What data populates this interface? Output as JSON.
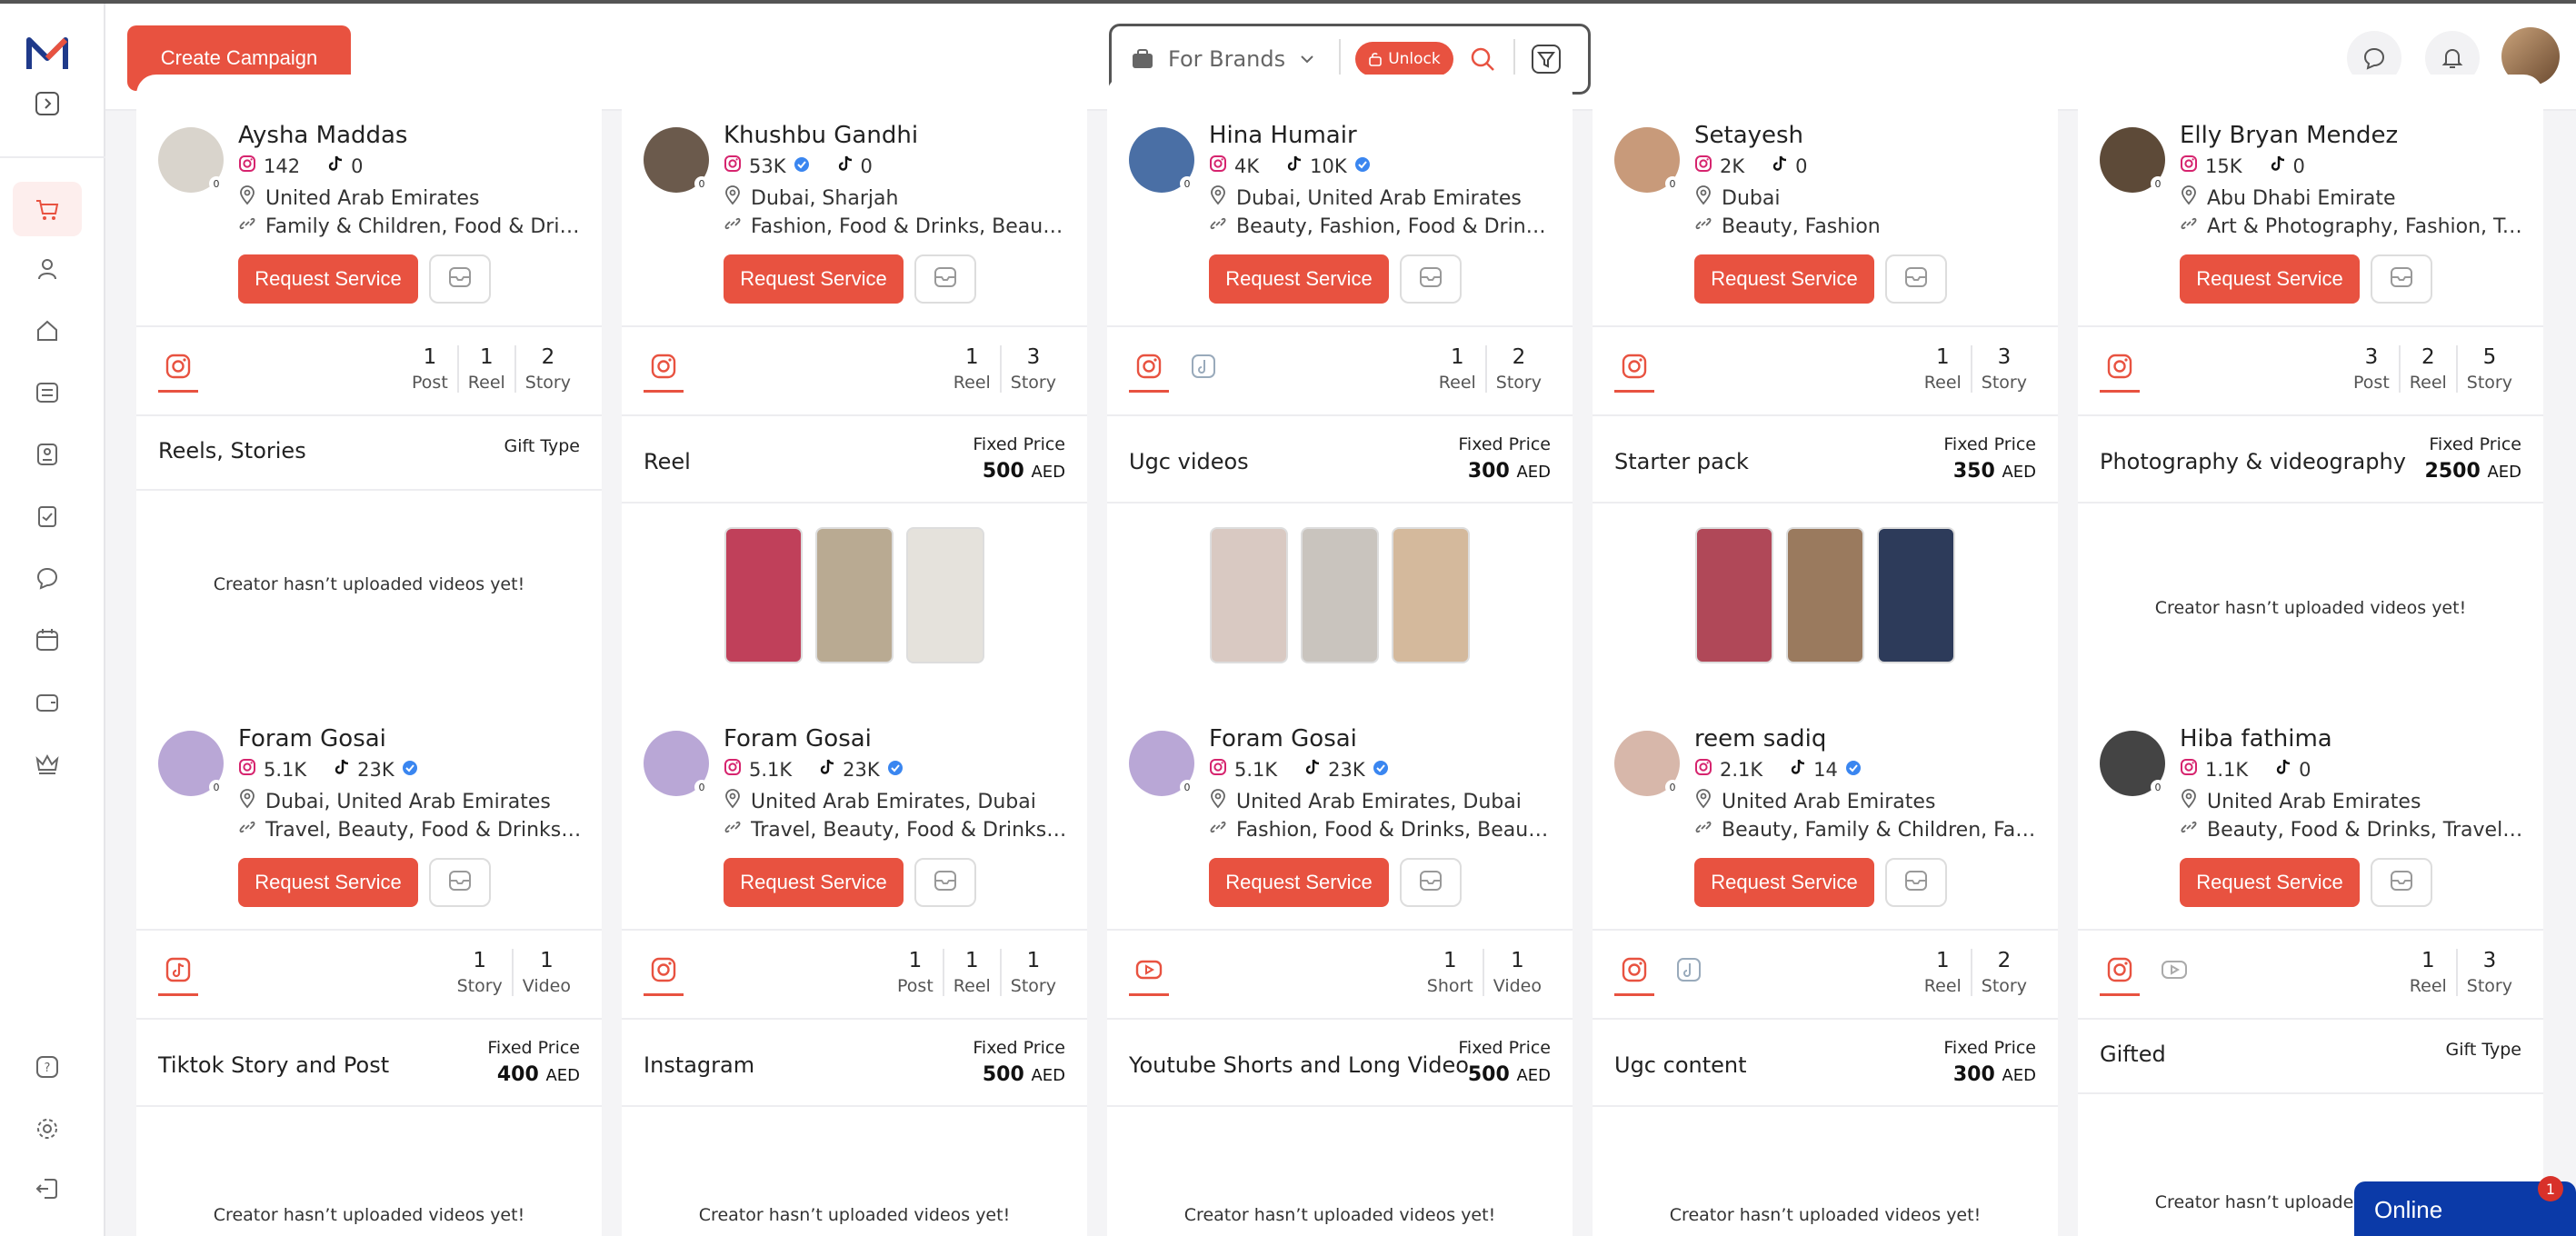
{
  "header": {
    "create_label": "Create Campaign",
    "brand_select": "For Brands",
    "unlock_label": "Unlock"
  },
  "colors": {
    "accent": "#e85240",
    "online": "#0b3aa8"
  },
  "cards": [
    {
      "name": "Aysha Maddas",
      "ig": "142",
      "tt": "0",
      "verified_ig": false,
      "verified_tt": false,
      "location": "United Arab Emirates",
      "categories": "Family & Children, Food & Drink…",
      "request": "Request Service",
      "counts": [
        {
          "n": "1",
          "l": "Post"
        },
        {
          "n": "1",
          "l": "Reel"
        },
        {
          "n": "2",
          "l": "Story"
        }
      ],
      "service": "Reels, Stories",
      "price_label": "Gift Type",
      "price_value": "",
      "currency": "",
      "no_videos": "Creator hasn’t uploaded videos yet!"
    },
    {
      "name": "Khushbu Gandhi",
      "ig": "53K",
      "tt": "0",
      "verified_ig": true,
      "verified_tt": false,
      "location": "Dubai, Sharjah",
      "categories": "Fashion, Food & Drinks, Beauty, …",
      "request": "Request Service",
      "counts": [
        {
          "n": "1",
          "l": "Reel"
        },
        {
          "n": "3",
          "l": "Story"
        }
      ],
      "service": "Reel",
      "price_label": "Fixed Price",
      "price_value": "500",
      "currency": "AED",
      "no_videos": ""
    },
    {
      "name": "Hina Humair",
      "ig": "4K",
      "tt": "10K",
      "verified_ig": false,
      "verified_tt": true,
      "location": "Dubai, United Arab Emirates",
      "categories": "Beauty, Fashion, Food & Drinks, …",
      "request": "Request Service",
      "counts": [
        {
          "n": "1",
          "l": "Reel"
        },
        {
          "n": "2",
          "l": "Story"
        }
      ],
      "service": "Ugc videos",
      "price_label": "Fixed Price",
      "price_value": "300",
      "currency": "AED",
      "no_videos": ""
    },
    {
      "name": "Setayesh",
      "ig": "2K",
      "tt": "0",
      "verified_ig": false,
      "verified_tt": false,
      "location": "Dubai",
      "categories": "Beauty, Fashion",
      "request": "Request Service",
      "counts": [
        {
          "n": "1",
          "l": "Reel"
        },
        {
          "n": "3",
          "l": "Story"
        }
      ],
      "service": "Starter pack",
      "price_label": "Fixed Price",
      "price_value": "350",
      "currency": "AED",
      "no_videos": ""
    },
    {
      "name": "Elly Bryan Mendez",
      "ig": "15K",
      "tt": "0",
      "verified_ig": false,
      "verified_tt": false,
      "location": "Abu Dhabi Emirate",
      "categories": "Art & Photography, Fashion, Te…",
      "request": "Request Service",
      "counts": [
        {
          "n": "3",
          "l": "Post"
        },
        {
          "n": "2",
          "l": "Reel"
        },
        {
          "n": "5",
          "l": "Story"
        }
      ],
      "service": "Photography & videography",
      "price_label": "Fixed Price",
      "price_value": "2500",
      "currency": "AED",
      "no_videos": "Creator hasn’t uploaded videos yet!"
    },
    {
      "name": "Foram Gosai",
      "ig": "5.1K",
      "tt": "23K",
      "verified_ig": false,
      "verified_tt": true,
      "location": "Dubai, United Arab Emirates",
      "categories": "Travel, Beauty, Food & Drinks, F…",
      "request": "Request Service",
      "counts": [
        {
          "n": "1",
          "l": "Story"
        },
        {
          "n": "1",
          "l": "Video"
        }
      ],
      "service": "Tiktok Story and Post",
      "price_label": "Fixed Price",
      "price_value": "400",
      "currency": "AED",
      "no_videos": "Creator hasn’t uploaded videos yet!"
    },
    {
      "name": "Foram Gosai",
      "ig": "5.1K",
      "tt": "23K",
      "verified_ig": false,
      "verified_tt": true,
      "location": "United Arab Emirates, Dubai",
      "categories": "Travel, Beauty, Food & Drinks, F…",
      "request": "Request Service",
      "counts": [
        {
          "n": "1",
          "l": "Post"
        },
        {
          "n": "1",
          "l": "Reel"
        },
        {
          "n": "1",
          "l": "Story"
        }
      ],
      "service": "Instagram",
      "price_label": "Fixed Price",
      "price_value": "500",
      "currency": "AED",
      "no_videos": "Creator hasn’t uploaded videos yet!"
    },
    {
      "name": "Foram Gosai",
      "ig": "5.1K",
      "tt": "23K",
      "verified_ig": false,
      "verified_tt": true,
      "location": "United Arab Emirates, Dubai",
      "categories": "Fashion, Food & Drinks, Beauty, …",
      "request": "Request Service",
      "counts": [
        {
          "n": "1",
          "l": "Short"
        },
        {
          "n": "1",
          "l": "Video"
        }
      ],
      "service": "Youtube Shorts and Long Video",
      "price_label": "Fixed Price",
      "price_value": "500",
      "currency": "AED",
      "no_videos": "Creator hasn’t uploaded videos yet!"
    },
    {
      "name": "reem sadiq",
      "ig": "2.1K",
      "tt": "14",
      "verified_ig": false,
      "verified_tt": true,
      "location": "United Arab Emirates",
      "categories": "Beauty, Family & Children, Fash…",
      "request": "Request Service",
      "counts": [
        {
          "n": "1",
          "l": "Reel"
        },
        {
          "n": "2",
          "l": "Story"
        }
      ],
      "service": "Ugc content",
      "price_label": "Fixed Price",
      "price_value": "300",
      "currency": "AED",
      "no_videos": "Creator hasn’t uploaded videos yet!"
    },
    {
      "name": "Hiba fathima",
      "ig": "1.1K",
      "tt": "0",
      "verified_ig": false,
      "verified_tt": false,
      "location": "United Arab Emirates",
      "categories": "Beauty, Food & Drinks, Travel, H…",
      "request": "Request Service",
      "counts": [
        {
          "n": "1",
          "l": "Reel"
        },
        {
          "n": "3",
          "l": "Story"
        }
      ],
      "service": "Gifted",
      "price_label": "Gift Type",
      "price_value": "",
      "currency": "",
      "no_videos": "Creator hasn’t uploaded videos yet!"
    }
  ],
  "chat": {
    "label": "Online",
    "badge": "1"
  }
}
